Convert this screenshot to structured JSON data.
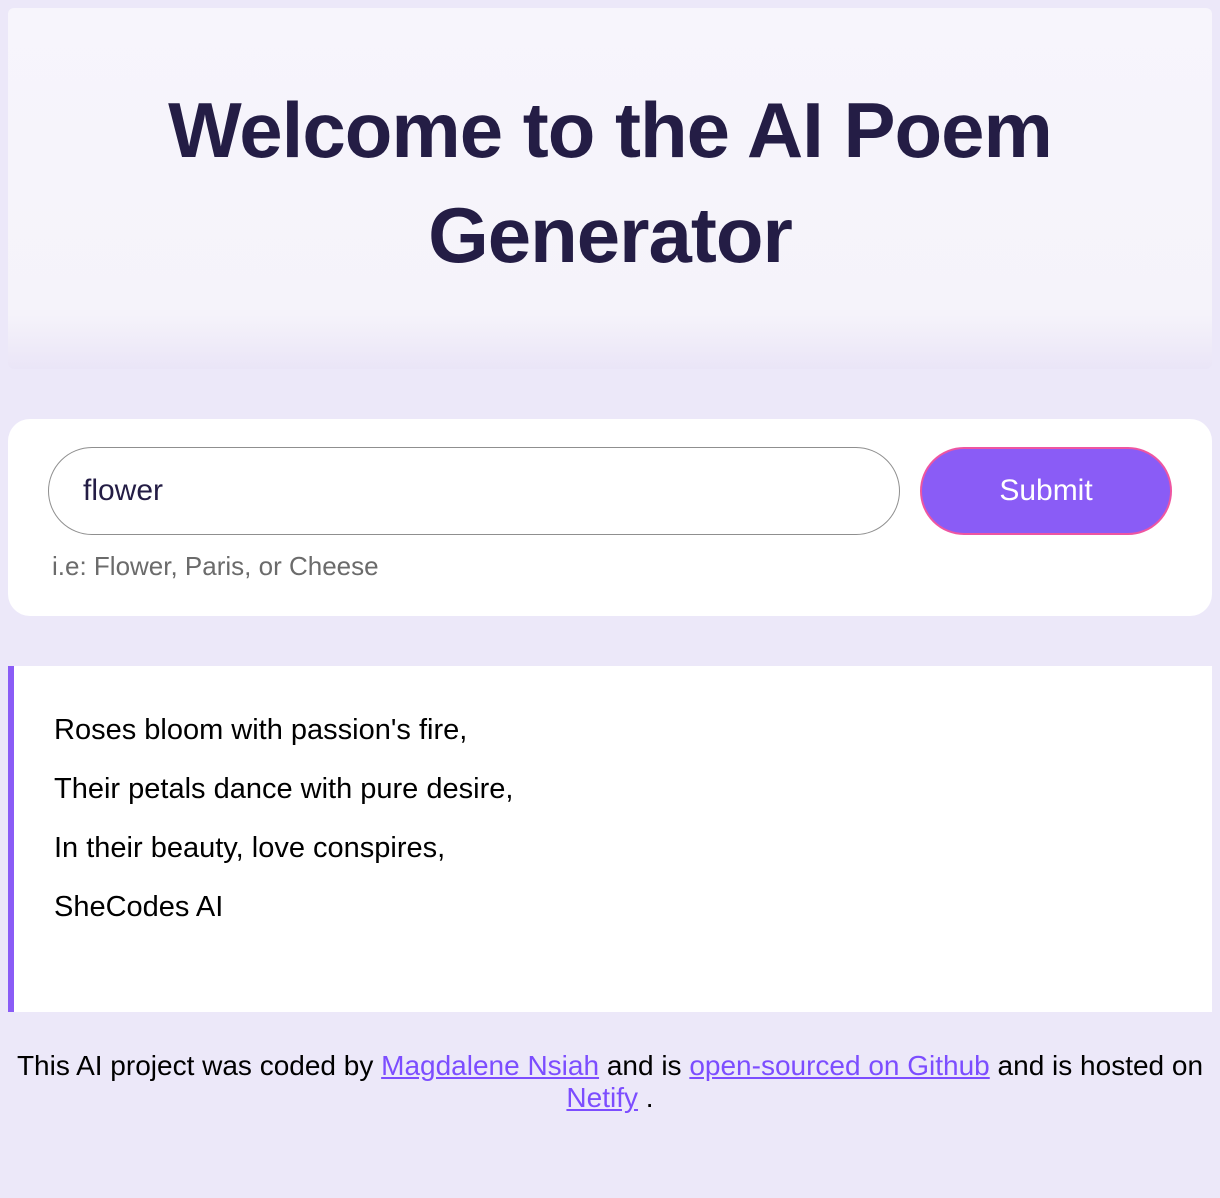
{
  "header": {
    "title": "Welcome to the AI Poem Generator"
  },
  "form": {
    "input_value": "flower",
    "input_placeholder": "",
    "hint": "i.e: Flower, Paris, or Cheese",
    "submit_label": "Submit"
  },
  "poem": {
    "lines": [
      "Roses bloom with passion's fire,",
      "Their petals dance with pure desire,",
      "In their beauty, love conspires,",
      "SheCodes AI"
    ]
  },
  "footer": {
    "prefix": "This AI project was coded by ",
    "author": "Magdalene Nsiah",
    "mid1": " and is ",
    "link_github": "open-sourced on Github",
    "mid2": " and is hosted on ",
    "link_host": "Netify",
    "suffix": " ."
  }
}
